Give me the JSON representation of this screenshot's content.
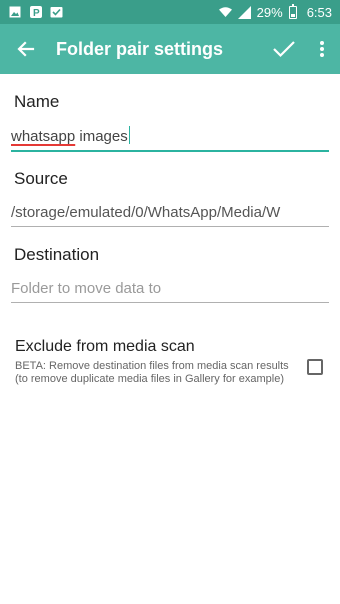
{
  "status_bar": {
    "battery_percent": "29%",
    "time": "6:53",
    "left_icons": [
      "image-icon",
      "parking-app-icon",
      "checklist-icon"
    ],
    "right_icons": [
      "wifi-icon",
      "signal-icon",
      "battery-icon"
    ]
  },
  "app_bar": {
    "title": "Folder pair settings",
    "background": "#4db6a4",
    "icons": {
      "back": "arrow-left-icon",
      "confirm": "check-icon",
      "more": "more-vert-icon"
    }
  },
  "form": {
    "name": {
      "label": "Name",
      "value_part1": "whatsapp",
      "value_part2": " images"
    },
    "source": {
      "label": "Source",
      "value": "/storage/emulated/0/WhatsApp/Media/W"
    },
    "destination": {
      "label": "Destination",
      "placeholder": "Folder to move data to"
    },
    "exclude": {
      "title": "Exclude from media scan",
      "description": "BETA: Remove destination files from media scan results (to remove duplicate media files in Gallery for example)",
      "checked": false
    }
  }
}
